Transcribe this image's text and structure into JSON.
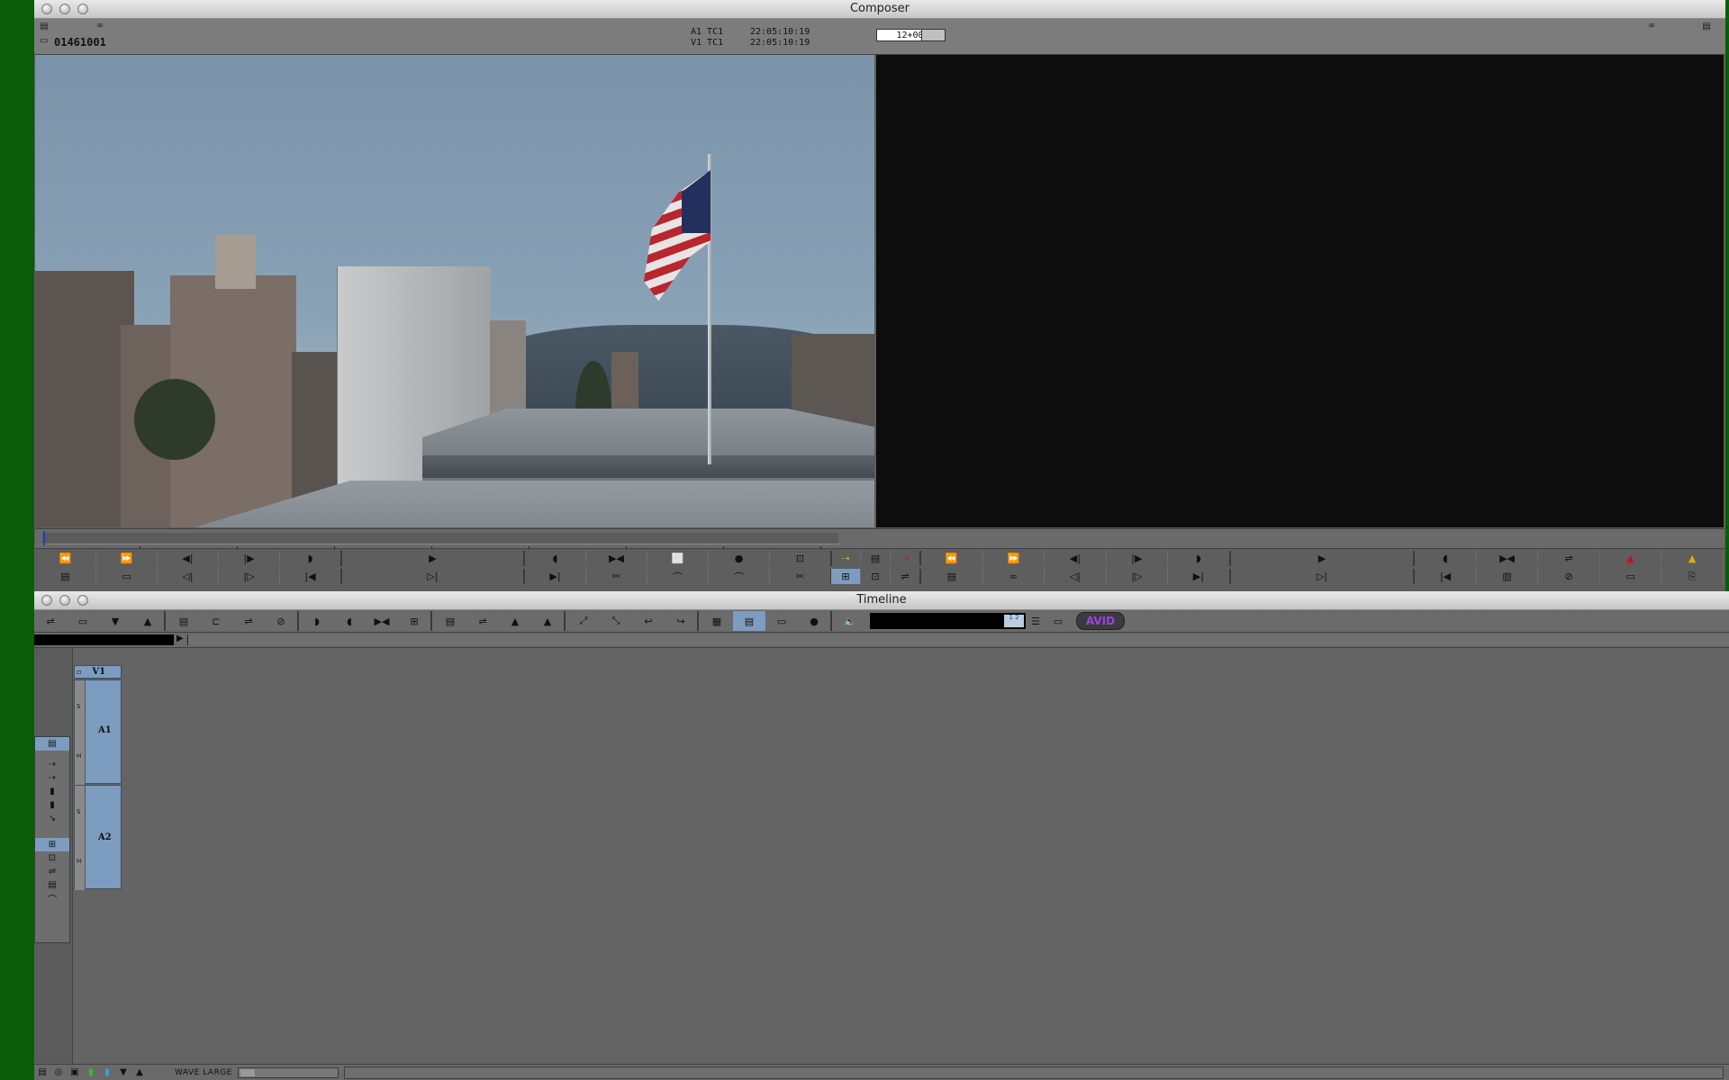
{
  "composer": {
    "title": "Composer",
    "clip_name": "01461001",
    "tc_lines": [
      {
        "track": "A1 TC1",
        "value": "22:05:10:19"
      },
      {
        "track": "V1 TC1",
        "value": "22:05:10:19"
      }
    ],
    "center_tc": "12+00",
    "pause_indicator": "II"
  },
  "source_controls_row1": [
    "⏪",
    "⏩",
    "◀|",
    "|▶",
    "◗",
    "▶",
    "◖",
    "▶◀",
    "⬜",
    "●",
    "⊡"
  ],
  "source_controls_row2": [
    "▤",
    "▭",
    "◁|",
    "|▷",
    "|◀",
    "▷|",
    "▶|",
    "✂",
    "⌒",
    "⌒",
    "✂"
  ],
  "record_controls_row1": [
    "⏪",
    "⏩",
    "◀|",
    "|▶",
    "◗",
    "▶",
    "◖",
    "▶◀",
    "⇌",
    "▲",
    "▲"
  ],
  "record_controls_row2": [
    "▤",
    "∞",
    "◁|",
    "|▷",
    "▶|",
    "▷|",
    "|◀",
    "▥",
    "⊘",
    "▭",
    "⎘"
  ],
  "center_controls_row1": [
    "⇢",
    "▤",
    "⇢"
  ],
  "center_controls_row2": [
    "⊞",
    "⊡",
    "⇌"
  ],
  "timeline": {
    "title": "Timeline",
    "toolbar_groups": [
      [
        "⇌",
        "▭",
        "▼",
        "▲"
      ],
      [
        "▤",
        "⊏",
        "⇌",
        "⊘"
      ],
      [
        "◗",
        "◖",
        "▶◀",
        "⊞"
      ],
      [
        "▤",
        "⇌",
        "▲",
        "▲"
      ],
      [
        "⤢",
        "⤡",
        "↩",
        "↪"
      ],
      [
        "▦",
        "▤",
        "▭",
        "●"
      ],
      [
        "🔈"
      ]
    ],
    "timecode_value": "",
    "mini_tc_label": "1\n2",
    "avid_logo": "AVID",
    "tracks": {
      "v1_label": "V1",
      "a1_label": "A1",
      "a2_label": "A2",
      "s_label": "S",
      "h_label": "H"
    },
    "side_palette": [
      "▤",
      "⇢",
      "⇢",
      "▮",
      "▮",
      "↘",
      "⊞",
      "⊡",
      "⇌",
      "▤",
      "⌒"
    ],
    "status_label": "WAVE LARGE",
    "status_buttons": [
      "▤",
      "◎",
      "▣",
      "▮",
      "▮",
      "▼",
      "▲"
    ]
  },
  "colors": {
    "selection_blue": "#7d9cc0",
    "record_red": "#c0141c",
    "lift_yellow": "#d9b000",
    "avid_purple": "#a042e0",
    "desktop_green": "#0a5c0a"
  }
}
